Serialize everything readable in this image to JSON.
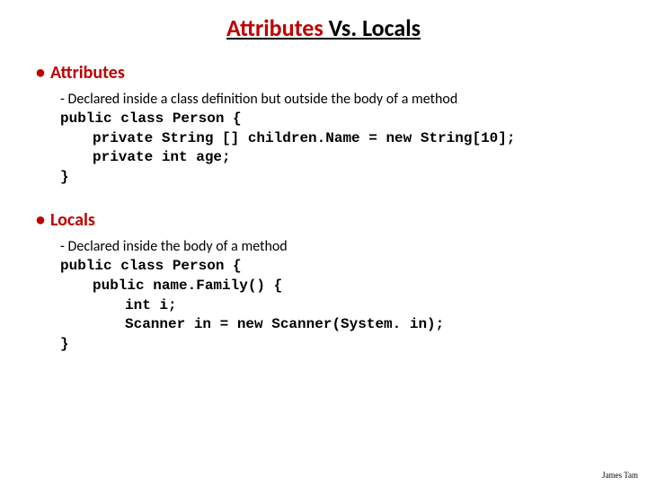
{
  "title_red": "Attributes",
  "title_black": " Vs. Locals",
  "sections": [
    {
      "header": "Attributes",
      "description": "- Declared inside a class definition but outside the body of a method",
      "code": [
        {
          "indent": 0,
          "text": "public class Person {"
        },
        {
          "indent": 1,
          "text": "private String [] children.Name = new String[10];"
        },
        {
          "indent": 1,
          "text": "private int age;"
        },
        {
          "indent": 0,
          "text": "}"
        }
      ]
    },
    {
      "header": "Locals",
      "description": "- Declared inside the body of a method",
      "code": [
        {
          "indent": 0,
          "text": "public class Person {"
        },
        {
          "indent": 1,
          "text": "public name.Family() {"
        },
        {
          "indent": 2,
          "text": "int i;"
        },
        {
          "indent": 2,
          "text": "Scanner in = new Scanner(System. in);"
        },
        {
          "indent": 0,
          "text": "}"
        }
      ]
    }
  ],
  "footer": "James Tam"
}
